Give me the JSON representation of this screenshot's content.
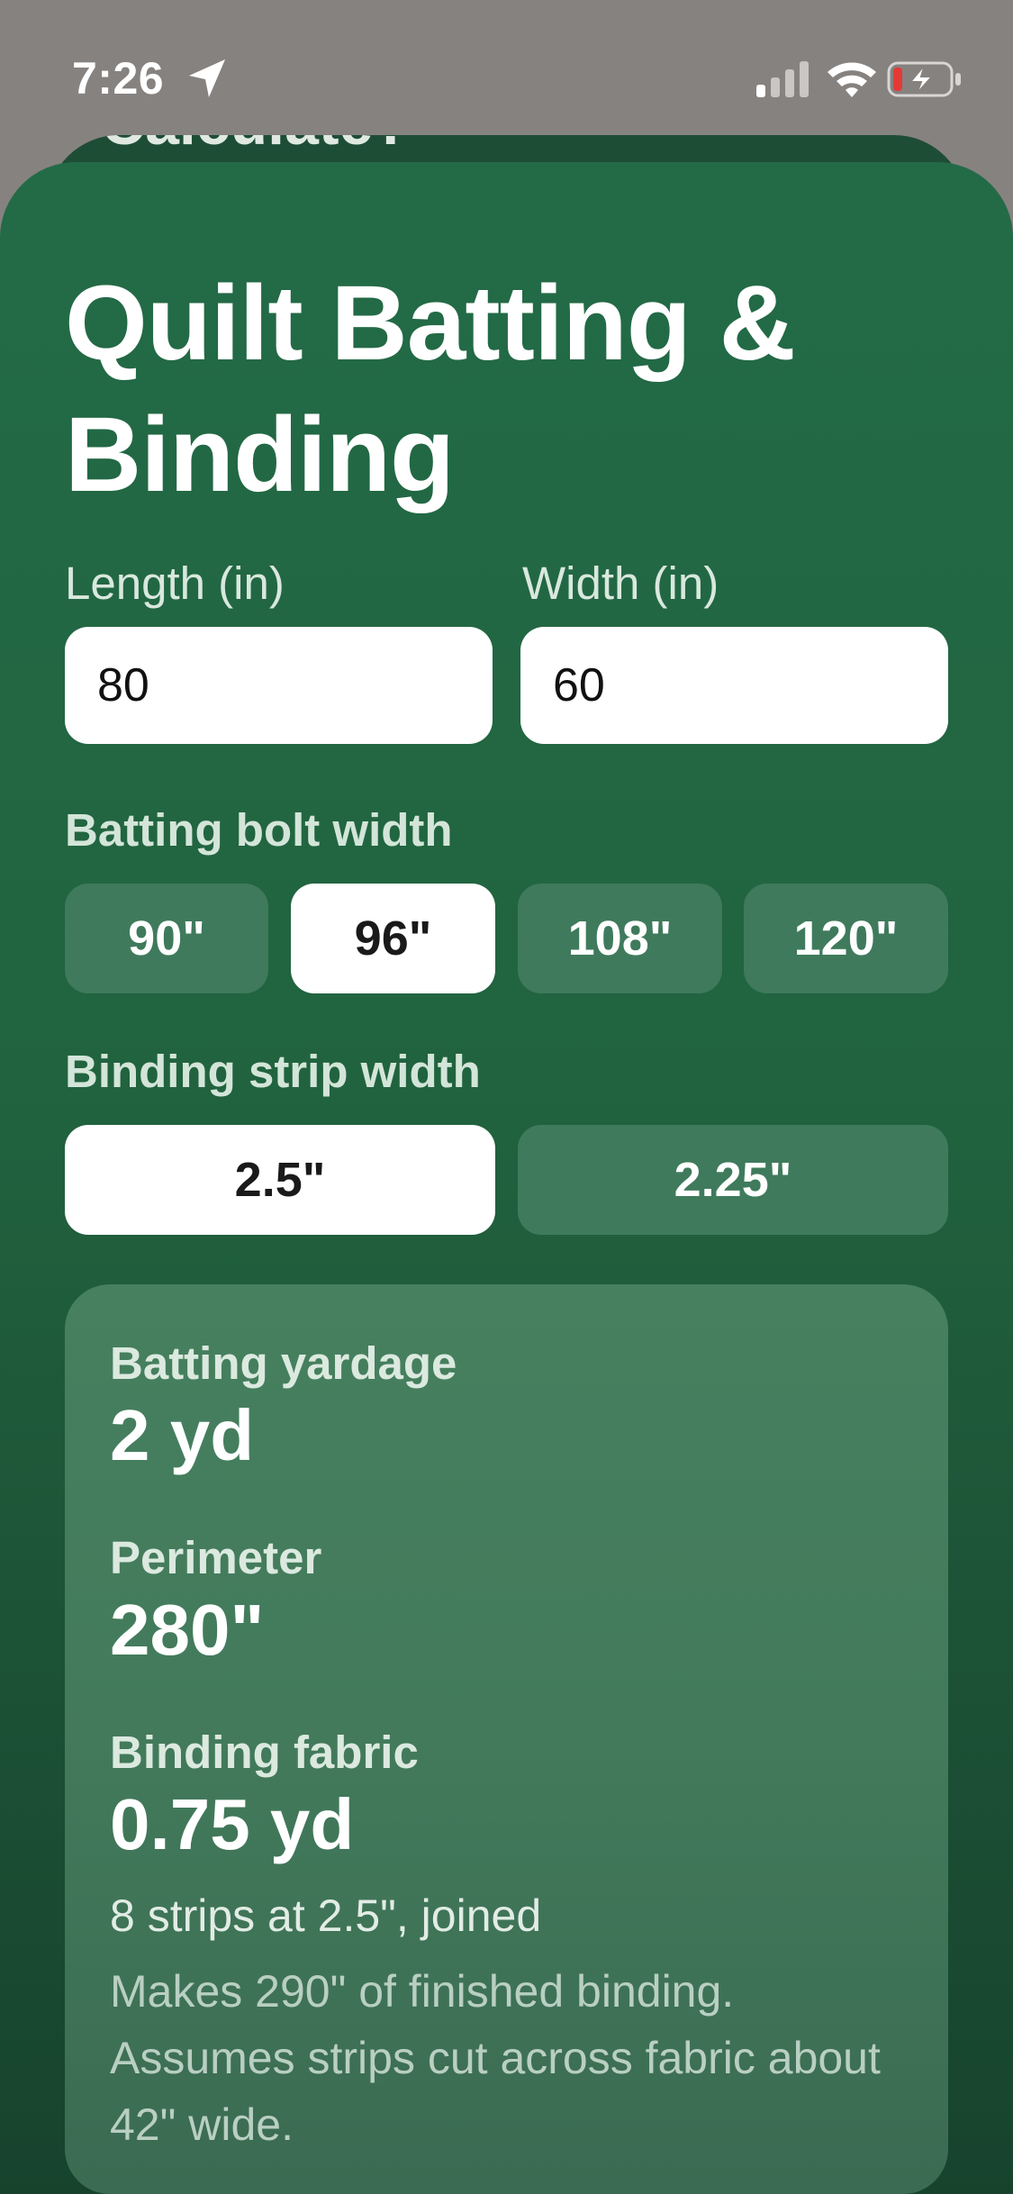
{
  "status_bar": {
    "time": "7:26",
    "icons": [
      "location-arrow-icon",
      "cellular-signal-icon",
      "wifi-icon",
      "battery-charging-icon"
    ]
  },
  "background_sheet": {
    "partial_title": "Calculate?"
  },
  "title": "Quilt Batting & Binding",
  "inputs": {
    "length": {
      "label": "Length (in)",
      "value": "80"
    },
    "width": {
      "label": "Width (in)",
      "value": "60"
    }
  },
  "batting_bolt": {
    "label": "Batting bolt width",
    "options": [
      "90\"",
      "96\"",
      "108\"",
      "120\""
    ],
    "selected": "96\""
  },
  "binding_strip": {
    "label": "Binding strip width",
    "options": [
      "2.5\"",
      "2.25\""
    ],
    "selected": "2.5\""
  },
  "results": {
    "batting_yardage": {
      "label": "Batting yardage",
      "value": "2 yd"
    },
    "perimeter": {
      "label": "Perimeter",
      "value": "280\""
    },
    "binding_fabric": {
      "label": "Binding fabric",
      "value": "0.75 yd",
      "detail": "8 strips at 2.5\", joined",
      "footnote": "Makes 290\" of finished binding. Assumes strips cut across fabric about 42\" wide."
    }
  },
  "colors": {
    "sheet_green": "#236b47",
    "option_unselected": "#3f7a5c",
    "option_selected": "#ffffff",
    "battery_low": "#e53935"
  }
}
